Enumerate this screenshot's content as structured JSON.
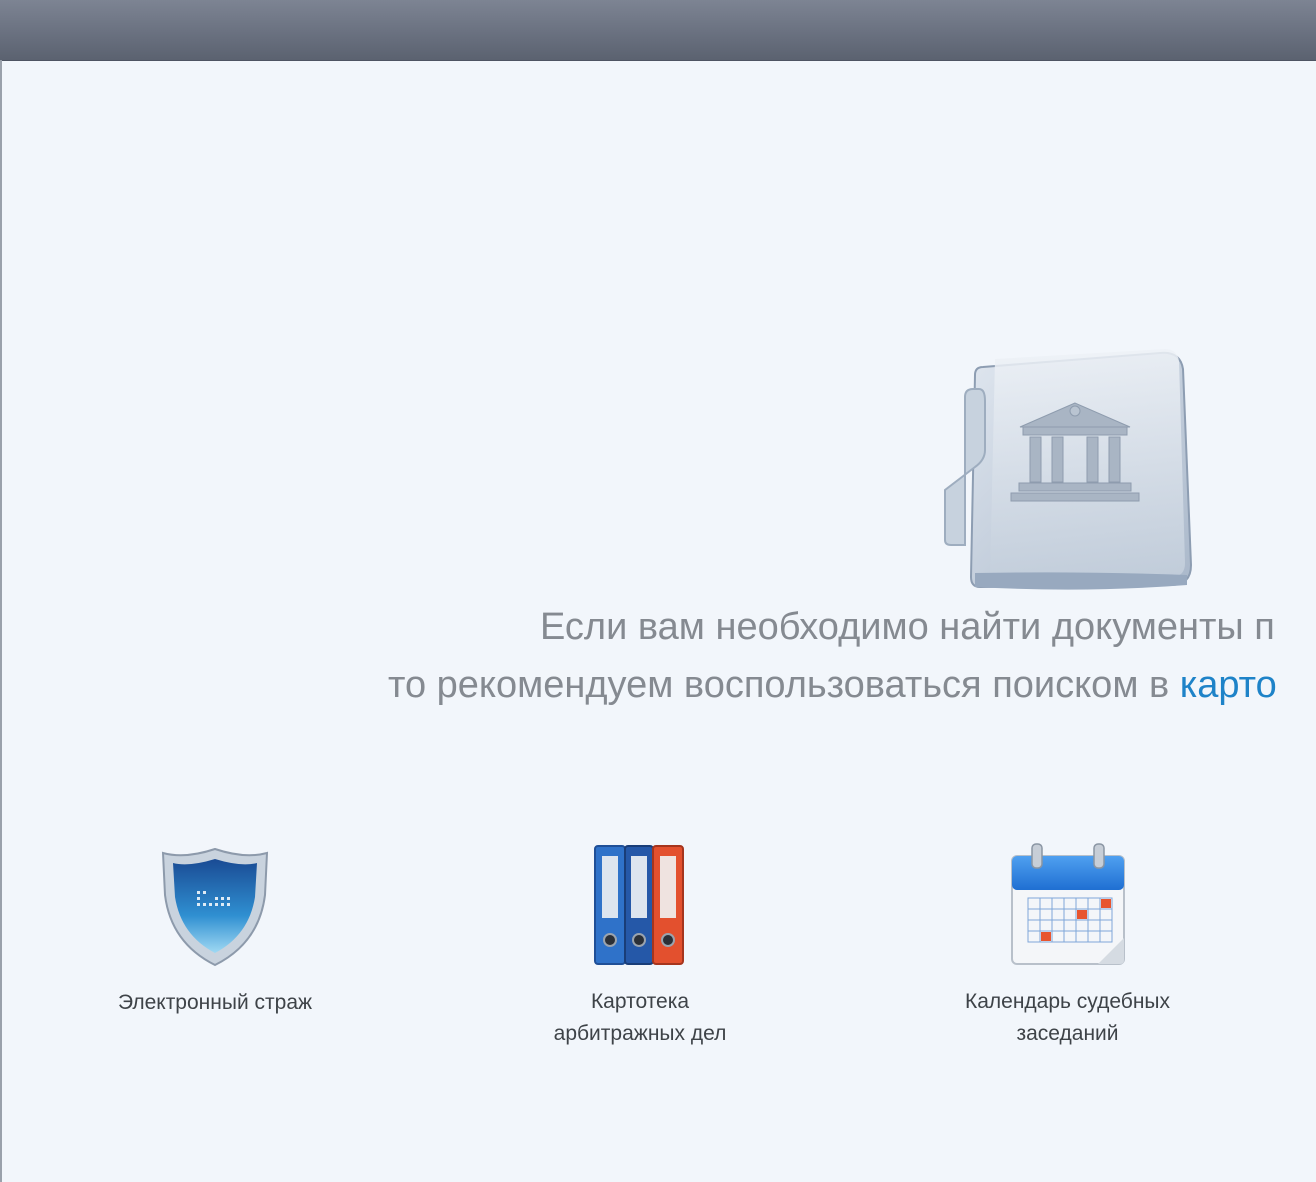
{
  "message": {
    "line1": "Если вам необходимо найти документы п",
    "line2_prefix": "то рекомендуем воспользоваться поиском в ",
    "line2_link": "карто"
  },
  "tiles": [
    {
      "label": "Электронный страж",
      "icon": "shield-icon"
    },
    {
      "label_line1": "Картотека",
      "label_line2": "арбитражных дел",
      "icon": "binders-icon"
    },
    {
      "label_line1": "Календарь судебных",
      "label_line2": "заседаний",
      "icon": "calendar-icon"
    }
  ],
  "colors": {
    "header": "#6a7180",
    "background": "#f2f6fb",
    "link": "#1e83c8",
    "message_text": "#858a91"
  }
}
